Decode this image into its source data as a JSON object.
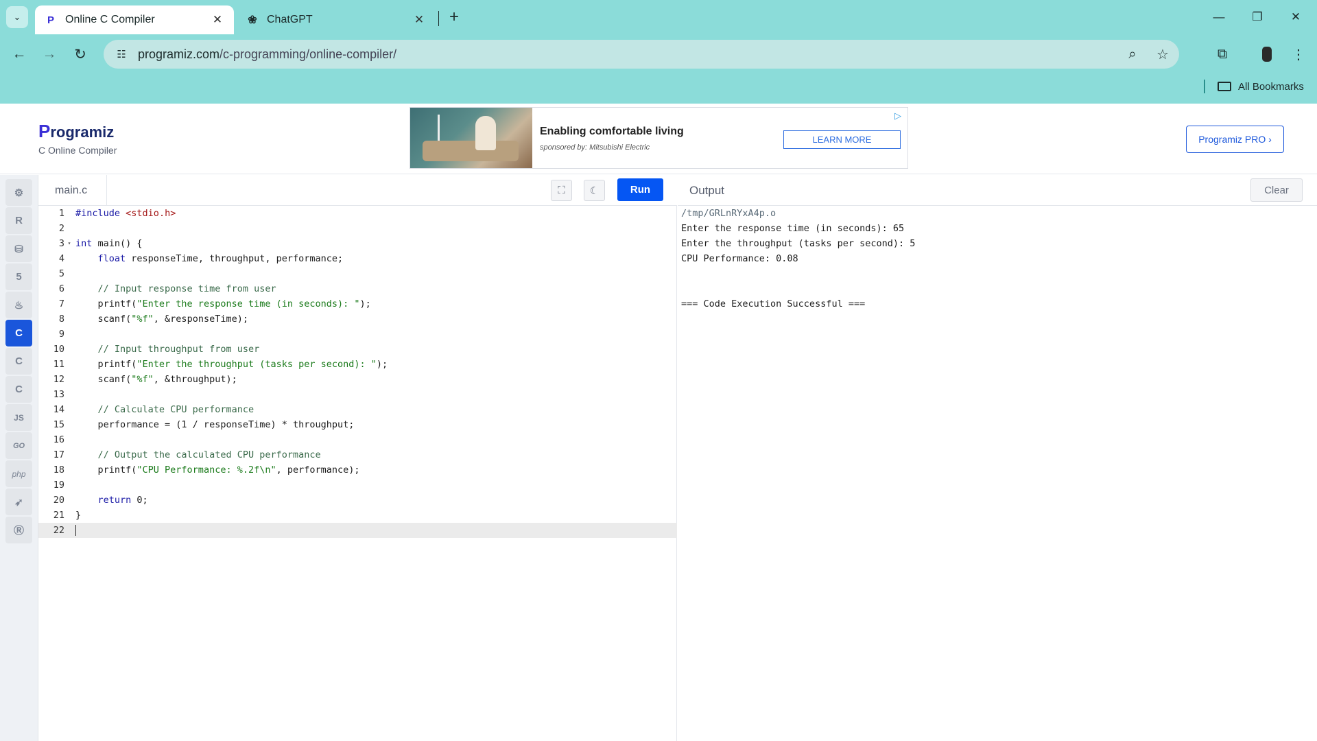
{
  "browser": {
    "tabs": [
      {
        "title": "Online C Compiler",
        "favicon": "programiz-p",
        "active": true
      },
      {
        "title": "ChatGPT",
        "favicon": "chatgpt-logo",
        "active": false
      }
    ],
    "url_host": "programiz.com",
    "url_path": "/c-programming/online-compiler/",
    "bookmarks_label": "All Bookmarks",
    "theme_color": "#8bdcd9"
  },
  "header": {
    "logo_p": "P",
    "logo_rest": "rogramiz",
    "subtitle": "C Online Compiler",
    "pro_button": "Programiz PRO ›"
  },
  "ad": {
    "title": "Enabling comfortable living",
    "sponsor": "sponsored by: Mitsubishi Electric",
    "cta": "LEARN MORE"
  },
  "sidebar": {
    "languages": [
      {
        "name": "python",
        "glyph": "🐍"
      },
      {
        "name": "r",
        "glyph": "R"
      },
      {
        "name": "sql",
        "glyph": "≡"
      },
      {
        "name": "html",
        "glyph": "5"
      },
      {
        "name": "java",
        "glyph": "♨"
      },
      {
        "name": "c",
        "glyph": "C"
      },
      {
        "name": "cpp",
        "glyph": "C"
      },
      {
        "name": "csharp",
        "glyph": "C"
      },
      {
        "name": "javascript",
        "glyph": "JS"
      },
      {
        "name": "go",
        "glyph": "GO"
      },
      {
        "name": "php",
        "glyph": "php"
      },
      {
        "name": "swift",
        "glyph": "➶"
      },
      {
        "name": "rust",
        "glyph": "R"
      }
    ],
    "active": "c",
    "accent_color": "#1a56db"
  },
  "editor": {
    "filename": "main.c",
    "run_label": "Run",
    "line_numbers": [
      "1",
      "2",
      "3",
      "4",
      "5",
      "6",
      "7",
      "8",
      "9",
      "10",
      "11",
      "12",
      "13",
      "14",
      "15",
      "16",
      "17",
      "18",
      "19",
      "20",
      "21",
      "22"
    ],
    "lines": [
      "#include <stdio.h>",
      "",
      "int main() {",
      "    float responseTime, throughput, performance;",
      "",
      "    // Input response time from user",
      "    printf(\"Enter the response time (in seconds): \");",
      "    scanf(\"%f\", &responseTime);",
      "",
      "    // Input throughput from user",
      "    printf(\"Enter the throughput (tasks per second): \");",
      "    scanf(\"%f\", &throughput);",
      "",
      "    // Calculate CPU performance",
      "    performance = (1 / responseTime) * throughput;",
      "",
      "    // Output the calculated CPU performance",
      "    printf(\"CPU Performance: %.2f\\n\", performance);",
      "",
      "    return 0;",
      "}",
      ""
    ],
    "current_line": "22"
  },
  "output": {
    "title": "Output",
    "clear_label": "Clear",
    "lines": [
      "/tmp/GRLnRYxA4p.o",
      "Enter the response time (in seconds): 65",
      "Enter the throughput (tasks per second): 5",
      "CPU Performance: 0.08",
      "",
      "",
      "=== Code Execution Successful ==="
    ]
  }
}
